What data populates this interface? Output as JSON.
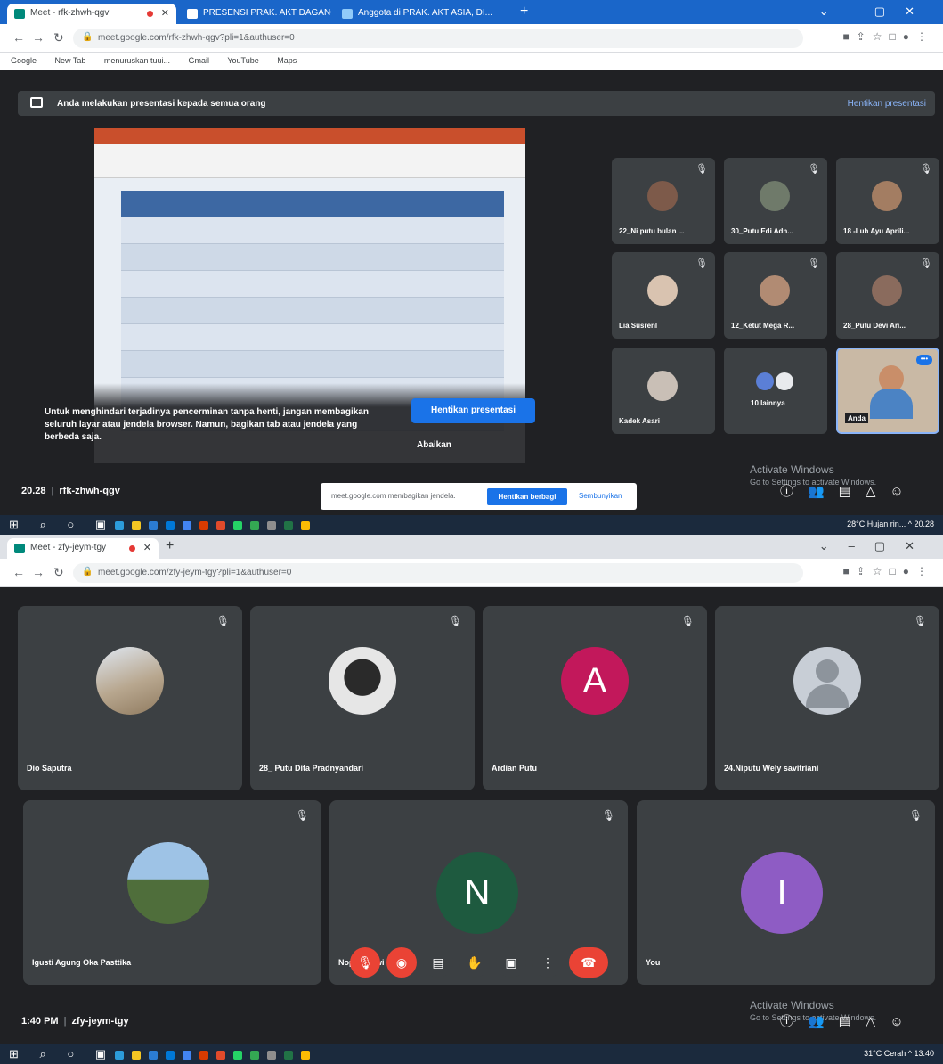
{
  "screen1": {
    "tabs": [
      {
        "label": "Meet - rfk-zhwh-qgv",
        "active": true
      },
      {
        "label": "PRESENSI PRAK. AKT DAGANG",
        "active": false
      },
      {
        "label": "Anggota di PRAK. AKT ASIA, DI...",
        "active": false
      }
    ],
    "url": "meet.google.com/rfk-zhwh-qgv?pli=1&authuser=0",
    "bookmarks": [
      "Google",
      "New Tab",
      "menuruskan tuui...",
      "Gmail",
      "YouTube",
      "Maps"
    ],
    "banner": {
      "text": "Anda melakukan presentasi kepada semua orang",
      "action": "Hentikan presentasi"
    },
    "warning": "Untuk menghindari terjadinya pencerminan tanpa henti, jangan membagikan seluruh layar atau jendela browser. Namun, bagikan tab atau jendela yang berbeda saja.",
    "stop_button": "Hentikan presentasi",
    "ignore": "Abaikan",
    "participants": [
      {
        "name": "22_Ni putu bulan ..."
      },
      {
        "name": "30_Putu Edi Adn..."
      },
      {
        "name": "18 -Luh Ayu Aprili..."
      },
      {
        "name": "Lia Susrenl"
      },
      {
        "name": "12_Ketut Mega R..."
      },
      {
        "name": "28_Putu Devi Ari..."
      },
      {
        "name": "Kadek Asari"
      },
      {
        "name": "10 lainnya"
      },
      {
        "name": "Anda"
      }
    ],
    "time": "20.28",
    "code": "rfk-zhwh-qgv",
    "sharebar": {
      "text": "meet.google.com membagikan jendela.",
      "stop": "Hentikan berbagi",
      "hide": "Sembunyikan"
    },
    "activate": {
      "title": "Activate Windows",
      "sub": "Go to Settings to activate Windows."
    },
    "tray": "28°C Hujan rin... ^ 20.28"
  },
  "screen2": {
    "tabs": [
      {
        "label": "Meet - zfy-jeym-tgy",
        "active": true
      }
    ],
    "url": "meet.google.com/zfy-jeym-tgy?pli=1&authuser=0",
    "tiles": [
      {
        "name": "Dio Saputra"
      },
      {
        "name": "28_ Putu Dita Pradnyandari"
      },
      {
        "name": "Ardian Putu",
        "initial": "A",
        "color": "#c2185b"
      },
      {
        "name": "24.Niputu Wely savitriani"
      },
      {
        "name": "Igusti Agung Oka Pasttika"
      },
      {
        "name": "Nopita Dewi",
        "initial": "N",
        "color": "#1e5a3f"
      },
      {
        "name": "You",
        "initial": "I",
        "color": "#8e5cc4"
      }
    ],
    "time": "1:40 PM",
    "code": "zfy-jeym-tgy",
    "activate": {
      "title": "Activate Windows",
      "sub": "Go to Settings to activate Windows."
    },
    "tray": "31°C Cerah ^ 13.40"
  },
  "colors": {
    "meet_bg": "#202124",
    "tile_bg": "#3c4043",
    "chrome_blue": "#1a66c9",
    "accent": "#1a73e8",
    "danger": "#ea4335"
  }
}
